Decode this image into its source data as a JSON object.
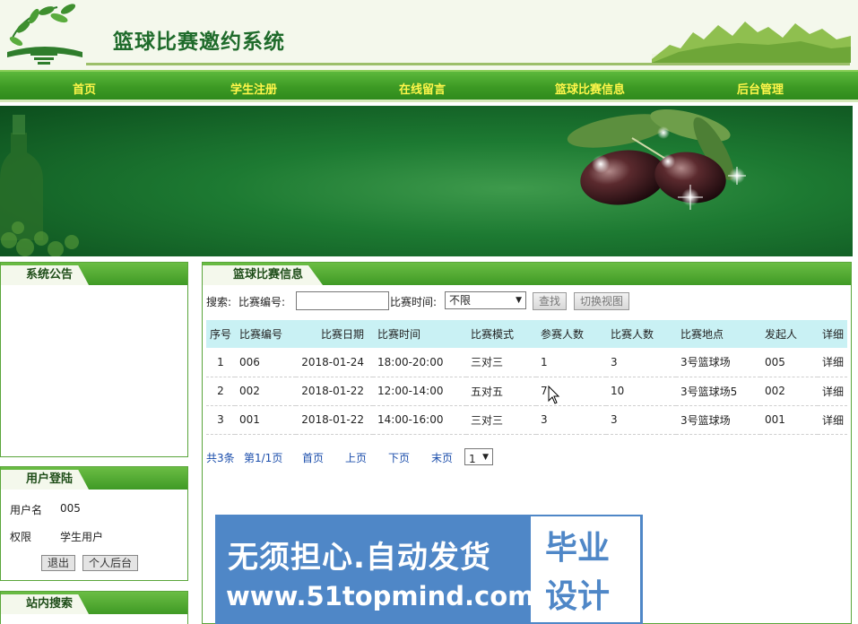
{
  "header": {
    "title": "篮球比赛邀约系统"
  },
  "nav": [
    {
      "label": "首页"
    },
    {
      "label": "学生注册"
    },
    {
      "label": "在线留言"
    },
    {
      "label": "篮球比赛信息"
    },
    {
      "label": "后台管理"
    }
  ],
  "notice": {
    "title": "系统公告"
  },
  "login": {
    "title": "用户登陆",
    "username_label": "用户名",
    "username_value": "005",
    "role_label": "权限",
    "role_value": "学生用户",
    "logout_button": "退出",
    "backend_button": "个人后台"
  },
  "site_search": {
    "title": "站内搜索"
  },
  "main": {
    "title": "篮球比赛信息",
    "search": {
      "label": "搜索:",
      "match_no_label": "比赛编号:",
      "match_no_value": "",
      "match_time_label": "比赛时间:",
      "match_time_selected": "不限",
      "find_button": "查找",
      "switch_view_button": "切换视图"
    },
    "table": {
      "headers": [
        "序号",
        "比赛编号",
        "比赛日期",
        "比赛时间",
        "比赛模式",
        "参赛人数",
        "比赛人数",
        "比赛地点",
        "发起人",
        "详细"
      ],
      "rows": [
        [
          "1",
          "006",
          "2018-01-24",
          "18:00-20:00",
          "三对三",
          "1",
          "3",
          "3号篮球场",
          "005",
          "详细"
        ],
        [
          "2",
          "002",
          "2018-01-22",
          "12:00-14:00",
          "五对五",
          "7",
          "10",
          "3号篮球场5",
          "002",
          "详细"
        ],
        [
          "3",
          "001",
          "2018-01-22",
          "14:00-16:00",
          "三对三",
          "3",
          "3",
          "3号篮球场",
          "001",
          "详细"
        ]
      ]
    },
    "pager": {
      "total": "共3条",
      "page_info": "第1/1页",
      "first": "首页",
      "prev": "上页",
      "next": "下页",
      "last": "末页",
      "page_select": "1"
    }
  },
  "ad": {
    "line1": "无须担心.自动发货",
    "line2": "www.51topmind.com",
    "box_line1": "毕业",
    "box_line2": "设计"
  },
  "colors": {
    "nav_green": "#3d9a24",
    "nav_text": "#fff64a",
    "title_green": "#1f6b2b",
    "table_header": "#c9f1f4",
    "ad_blue": "#4f87c7"
  }
}
